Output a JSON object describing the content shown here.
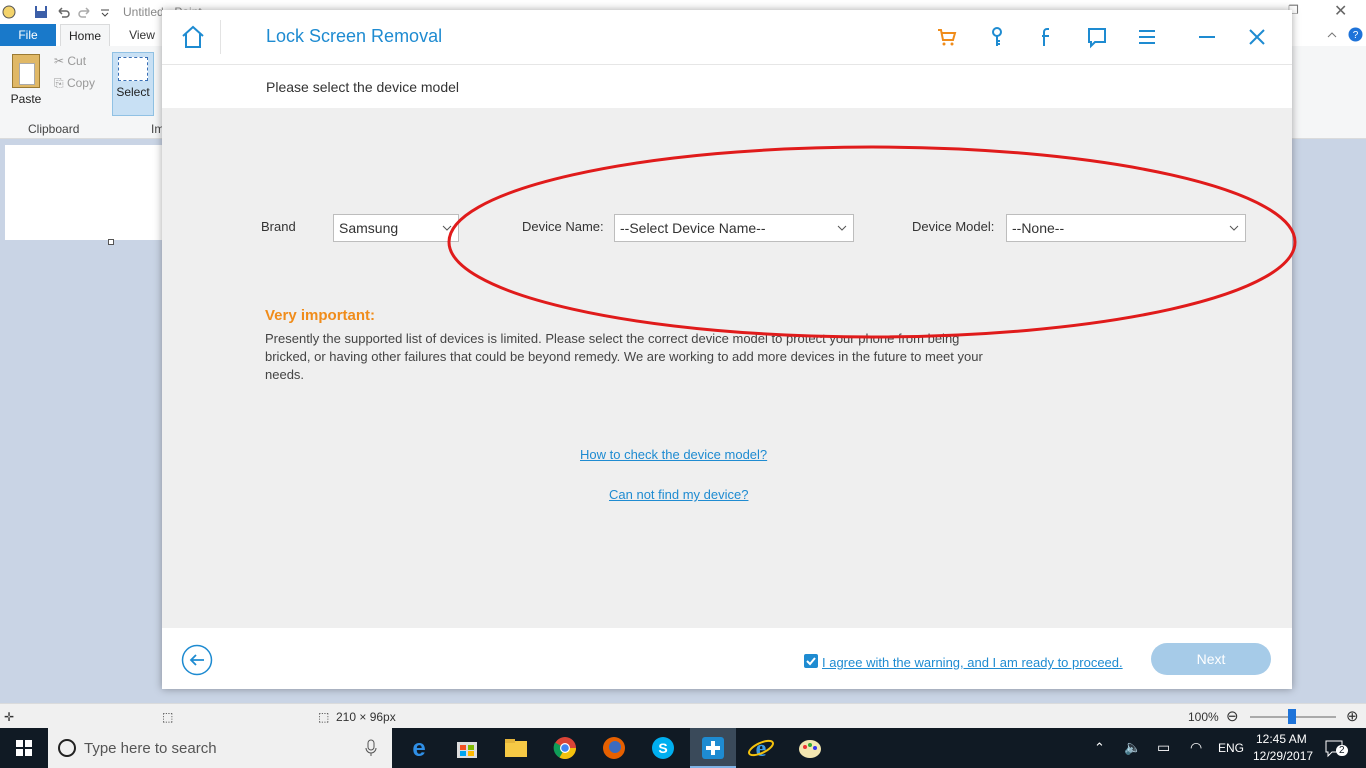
{
  "paint": {
    "title": "Untitled - Paint",
    "tabs": [
      "File",
      "Home",
      "View"
    ],
    "paste_label": "Paste",
    "cut_label": "Cut",
    "copy_label": "Copy",
    "clipboard_label": "Clipboard",
    "select_label": "Select",
    "image_label": "Im",
    "status_size": "210 × 96px",
    "zoom": "100%"
  },
  "dialog": {
    "title": "Lock Screen Removal",
    "subtitle": "Please select the device model",
    "header_icons": [
      "cart-icon",
      "key-icon",
      "facebook-icon",
      "feedback-icon",
      "menu-icon",
      "minimize-icon",
      "close-icon"
    ],
    "brand_label": "Brand",
    "brand_value": "Samsung",
    "device_name_label": "Device Name:",
    "device_name_value": "--Select Device Name--",
    "device_model_label": "Device Model:",
    "device_model_value": "--None--",
    "important_title": "Very important:",
    "important_text": "Presently the supported list of devices is limited. Please select the correct device model to protect your phone from being bricked, or having other failures that could be beyond remedy. We are working to add more devices in the future to meet your needs.",
    "link_check_model": "How to check the device model?",
    "link_cannot_find": "Can not find my device?",
    "agree_text": "I agree with the warning, and I am ready to proceed.",
    "agree_checked": true,
    "next_label": "Next",
    "accent_color": "#1e8bd1",
    "warning_color": "#f08c1a",
    "highlight_color": "#e01b1b"
  },
  "taskbar": {
    "search_placeholder": "Type here to search",
    "language": "ENG",
    "time": "12:45 AM",
    "date": "12/29/2017",
    "notifications": "2"
  }
}
